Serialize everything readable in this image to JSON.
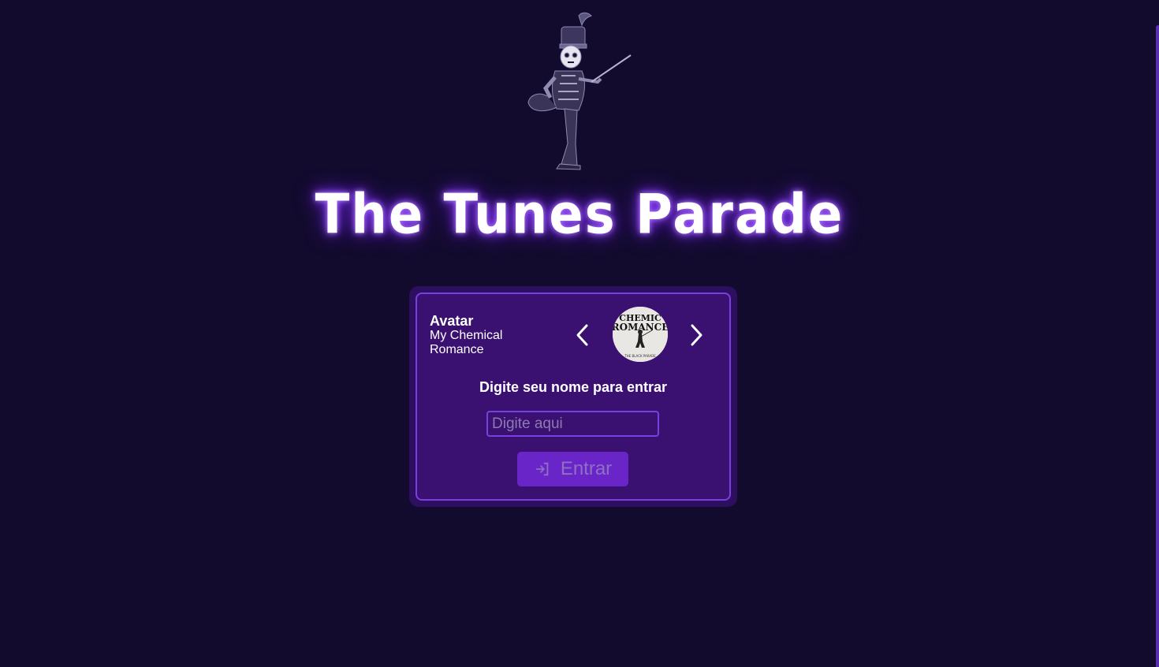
{
  "app": {
    "title": "The Tunes Parade"
  },
  "avatar": {
    "heading": "Avatar",
    "name_line1": "My Chemical",
    "name_line2": "Romance",
    "prev_icon": "chevron-left-icon",
    "next_icon": "chevron-right-icon",
    "album_icon": "album-cover"
  },
  "login": {
    "prompt": "Digite seu nome para entrar",
    "input_placeholder": "Digite aqui",
    "input_value": "",
    "button_label": "Entrar",
    "button_icon": "login-icon"
  },
  "colors": {
    "background": "#130b2e",
    "card_outer": "#2c0f5e",
    "card_inner": "#3a1170",
    "accent_border": "#7a3fe0",
    "button": "#6a25c9",
    "title_glow": "#8a3dff"
  }
}
